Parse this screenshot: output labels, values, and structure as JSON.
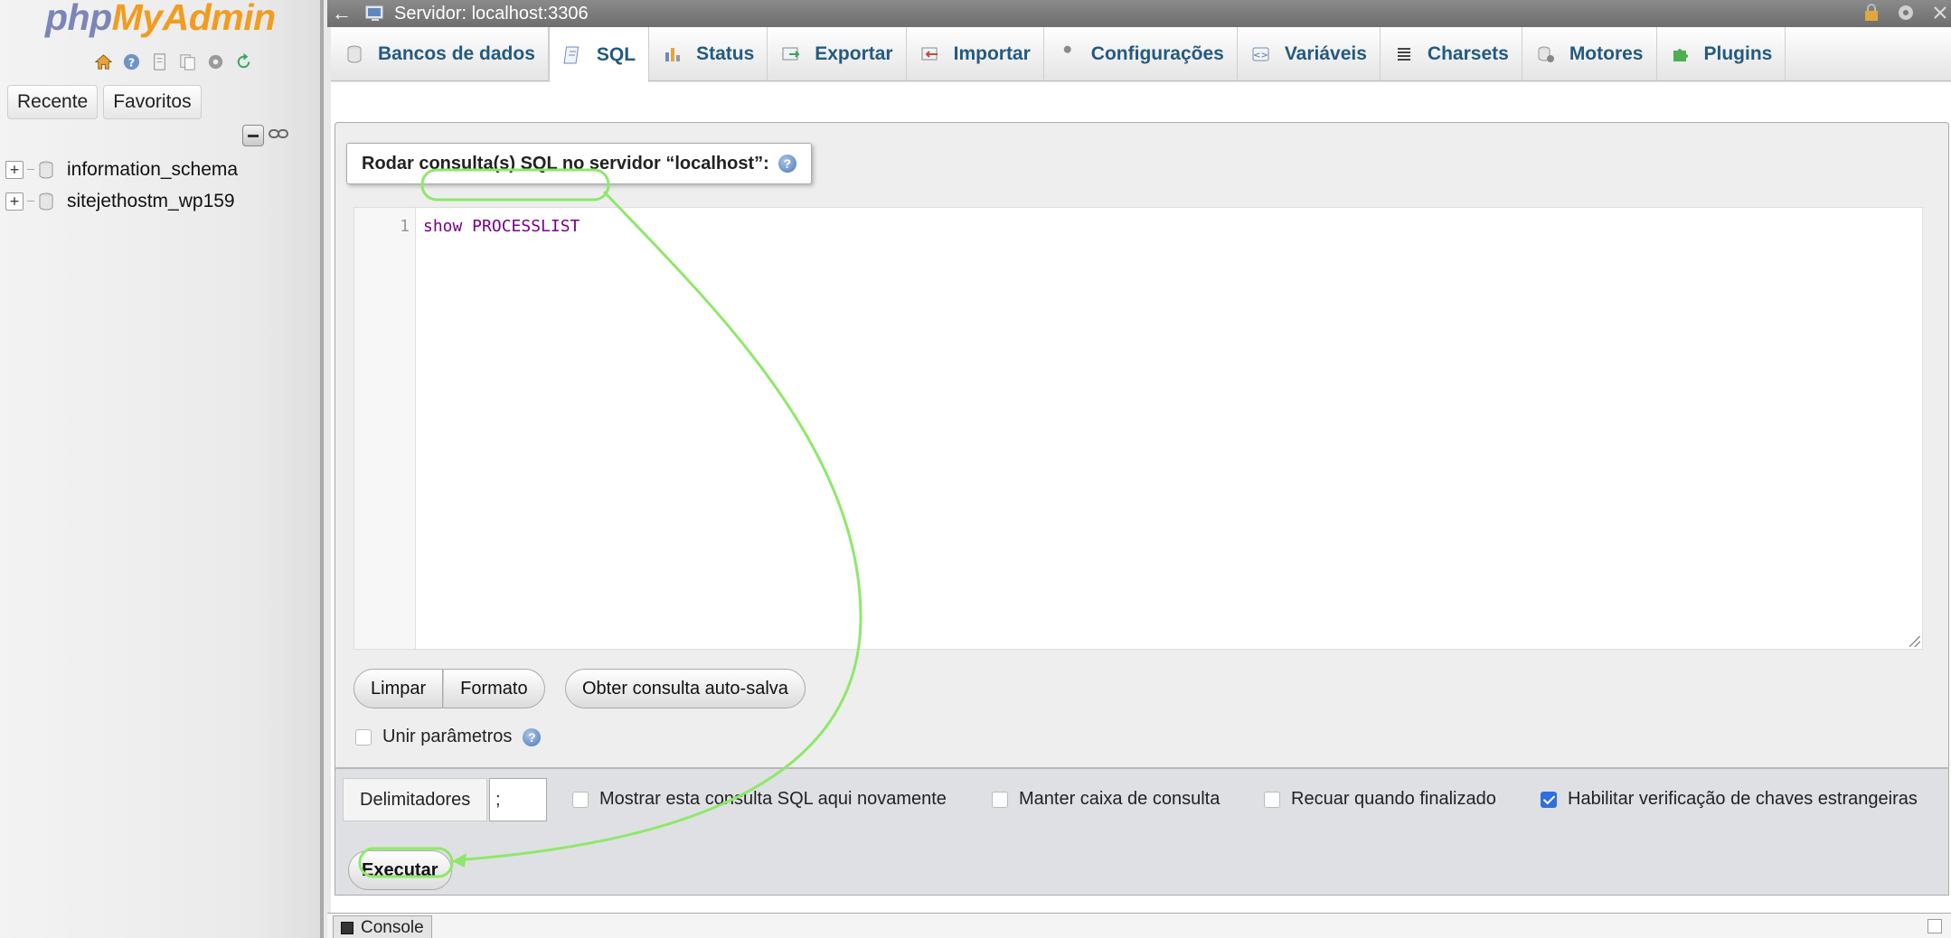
{
  "logo": {
    "php": "php",
    "myadmin": "MyAdmin"
  },
  "sidebar": {
    "tabs": [
      {
        "label": "Recente"
      },
      {
        "label": "Favoritos"
      }
    ],
    "databases": [
      {
        "name": "information_schema"
      },
      {
        "name": "sitejethostm_wp159"
      }
    ]
  },
  "topbar": {
    "back": "←",
    "server": "Servidor: localhost:3306"
  },
  "tabs": [
    {
      "label": "Bancos de dados"
    },
    {
      "label": "SQL"
    },
    {
      "label": "Status"
    },
    {
      "label": "Exportar"
    },
    {
      "label": "Importar"
    },
    {
      "label": "Configurações"
    },
    {
      "label": "Variáveis"
    },
    {
      "label": "Charsets"
    },
    {
      "label": "Motores"
    },
    {
      "label": "Plugins"
    }
  ],
  "sql": {
    "legend": "Rodar consulta(s) SQL no servidor “localhost”:",
    "line_number": "1",
    "query": "show PROCESSLIST",
    "buttons": {
      "clear": "Limpar",
      "format": "Formato",
      "autosave": "Obter consulta auto-salva"
    },
    "bind_params": "Unir parâmetros"
  },
  "options": {
    "delimiter_label": "Delimitadores",
    "delimiter_value": ";",
    "show_again": "Mostrar esta consulta SQL aqui novamente",
    "keep_box": "Manter caixa de consulta",
    "rollback": "Recuar quando finalizado",
    "fk_check": "Habilitar verificação de chaves estrangeiras",
    "execute": "Executar"
  },
  "console": {
    "label": "Console"
  },
  "colors": {
    "tab_text": "#235a81",
    "annotation": "#8ee86a",
    "checkbox_checked": "#2f6fdb"
  }
}
